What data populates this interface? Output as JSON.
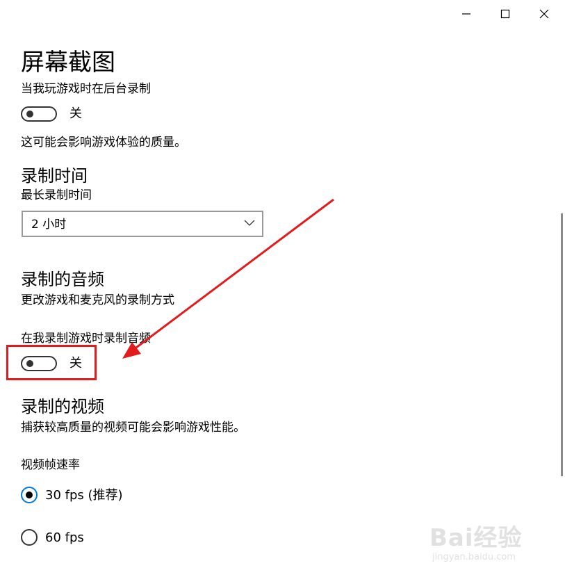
{
  "window": {
    "minimize_icon": "minimize-icon",
    "maximize_icon": "maximize-icon",
    "close_icon": "close-icon"
  },
  "page_title": "屏幕截图",
  "background_record": {
    "label": "当我玩游戏时在后台录制",
    "toggle_state": "关",
    "note": "这可能会影响游戏体验的质量。"
  },
  "record_time": {
    "title": "录制时间",
    "label": "最长录制时间",
    "selected": "2 小时"
  },
  "record_audio": {
    "title": "录制的音频",
    "description": "更改游戏和麦克风的录制方式",
    "label": "在我录制游戏时录制音频",
    "toggle_state": "关"
  },
  "record_video": {
    "title": "录制的视频",
    "description": "捕获较高质量的视频可能会影响游戏性能。",
    "fps_label": "视频帧速率",
    "options": [
      {
        "label": "30 fps (推荐)",
        "selected": true
      },
      {
        "label": "60 fps",
        "selected": false
      }
    ]
  },
  "colors": {
    "accent": "#0078d7",
    "annotation": "#e21c1c"
  },
  "watermark": {
    "main": "Bai经验",
    "sub": "jingyan.baidu.com"
  }
}
